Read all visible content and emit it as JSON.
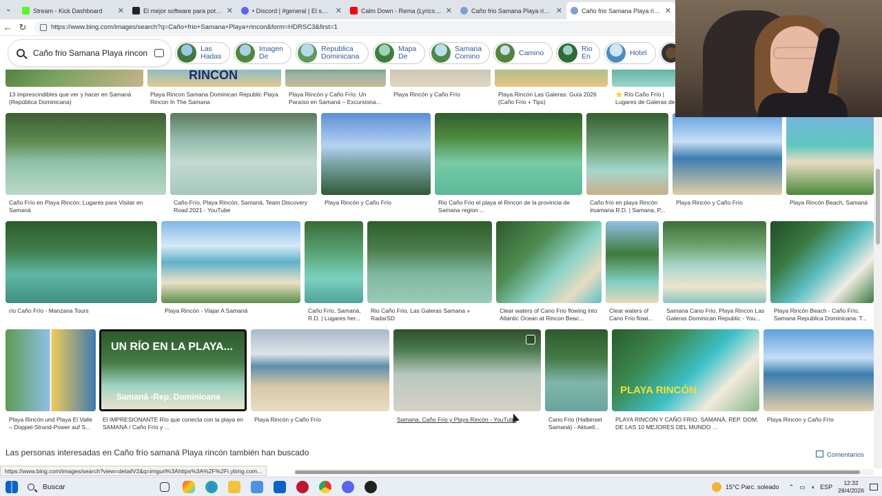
{
  "browser": {
    "tabs": [
      {
        "title": "Stream - Kick Dashboard",
        "color": "#53fc18"
      },
      {
        "title": "El mejor software para potenc",
        "color": "#222222"
      },
      {
        "title": "• Discord | #general | El servidor de",
        "color": "#5865f2"
      },
      {
        "title": "Calm Down - Rema (Lyrics) Ed She",
        "color": "#ff0000"
      },
      {
        "title": "Caño frio Samana Playa rincon - B",
        "color": "#2a5a9a"
      },
      {
        "title": "Caño frio Samana Playa rincon - B",
        "color": "#2a5a9a"
      }
    ],
    "url": "https://www.bing.com/images/search?q=Caño+frio+Samana+Playa+rincon&form=HDRSC3&first=1"
  },
  "search": {
    "query": "Caño frio Samana Playa rincon",
    "chips": [
      {
        "label1": "Las",
        "label2": "Hadas"
      },
      {
        "label1": "Imagen",
        "label2": "De"
      },
      {
        "label1": "Republica",
        "label2": "Dominicana"
      },
      {
        "label1": "Mapa",
        "label2": "De"
      },
      {
        "label1": "Samana",
        "label2": "Comino"
      },
      {
        "label1": "Camino",
        "label2": ""
      },
      {
        "label1": "Rio",
        "label2": "En"
      },
      {
        "label1": "Hotel",
        "label2": ""
      }
    ]
  },
  "results": {
    "captions": [
      "13 imprescindibles que ver y hacer en Samaná (República Dominicana)",
      "Playa Rincon Samana Dominican Republic Playa Rincon In The Samana",
      "Playa Rincón y Caño Frío: Un Paraíso en Samaná – Excursiona...",
      "Playa Rincón y Caño Frío",
      "Playa Rincón Las Galeras: Guía 2026 (Caño Frío + Tips)",
      "⭐ Río Caño Frío | Lugares de Galeras de Samaná.",
      "Caño Frío en Playa Rincón: Lugares para Visitar en Samaná",
      "Caño Frío, Playa Rincón, Samaná, Team Discovery Road 2021 - YouTube",
      "Playa Rincón y Caño Frío",
      "Rio Caño Frio el playa el Rincon de la provincia de Samana region ...",
      "Caño frío en playa Rincón #samana R.D. | Samana, P...",
      "Playa Rincón y Caño Frío",
      "Playa Rincón Beach, Samaná",
      "río Caño Frío - Manzana Tours",
      "Playa Rincón - Viajar A Samaná",
      "Caño Frío, Samaná, R.D. | Lugares her...",
      "Rio Caño Frio, Las Galeras Samana » RadarSD",
      "Clear waters of Cano Frio flowing into Atlantic Ocean at Rincon Beac...",
      "Clear waters of Cano Frio flowi...",
      "Samana Cano Frio, Playa Rincon Las Galeras Dominican Republic - You...",
      "Playa Rincón Beach - Caño Frío, Samana Republica Dominicana. T...",
      "Playa Rincón und Playa El Valle – Doppel-Strand-Power auf S...",
      "El IMPRESIONANTE Río que conecta con la playa en SAMANÁ / Caño Frío y ...",
      "Playa Rincón y Caño Frío",
      "Samana, Caño Frio y Playa Rincón - YouTube",
      "Cano Frio (Halbinsel Samaná) - Aktuell...",
      "PLAYA RINCON Y CAÑO FRIO, SAMANÁ, REP. DOM. DE LAS 10 MEJORES DEL MUNDO ...",
      "Playa Rincón y Caño Frío"
    ],
    "overlay_texts": [
      "RINCON",
      "UN RÍO EN LA PLAYA...",
      "Samaná -Rep. Dominicana",
      "PLAYA RINCÓN"
    ],
    "related": "Las personas interesadas en Caño frío samaná Playa rincón también han buscado",
    "comments": "Comentarios"
  },
  "status_url": "https://www.bing.com/images/search?view=detailV2&q=imgurl%3Ahttps%3A%2F%2Fi.ytimg.com...",
  "taskbar": {
    "search_label": "Buscar",
    "weather": "15°C  Parc. soleado",
    "lang": "ESP",
    "time": "12:32",
    "date": "28/4/2026"
  }
}
